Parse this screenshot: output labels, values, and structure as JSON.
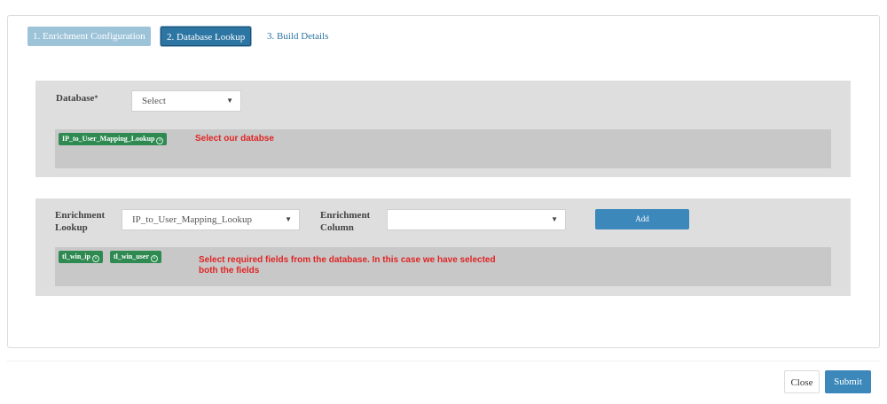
{
  "steps": [
    {
      "label": "1. Enrichment Configuration"
    },
    {
      "label": "2. Database Lookup"
    },
    {
      "label": "3. Build Details"
    }
  ],
  "database_section": {
    "label": "Database",
    "required_mark": "*",
    "select_value": "Select",
    "chips": [
      "IP_to_User_Mapping_Lookup"
    ],
    "annotation": "Select our databse"
  },
  "lookup_section": {
    "lookup_label_line1": "Enrichment",
    "lookup_label_line2": "Lookup",
    "lookup_value": "IP_to_User_Mapping_Lookup",
    "column_label_line1": "Enrichment",
    "column_label_line2": "Column",
    "column_value": "",
    "add_label": "Add",
    "chips": [
      "tl_win_ip",
      "tl_win_user"
    ],
    "annotation_line1": "Select required fields from the database. In this case we have selected",
    "annotation_line2": "both the fields"
  },
  "footer": {
    "close_label": "Close",
    "submit_label": "Submit"
  },
  "colors": {
    "accent": "#3c88bb",
    "chip": "#2f8a52",
    "annotation": "#e02424"
  },
  "icons": {
    "chip_remove": "close-circle-icon",
    "select_arrow": "caret-down-icon"
  }
}
